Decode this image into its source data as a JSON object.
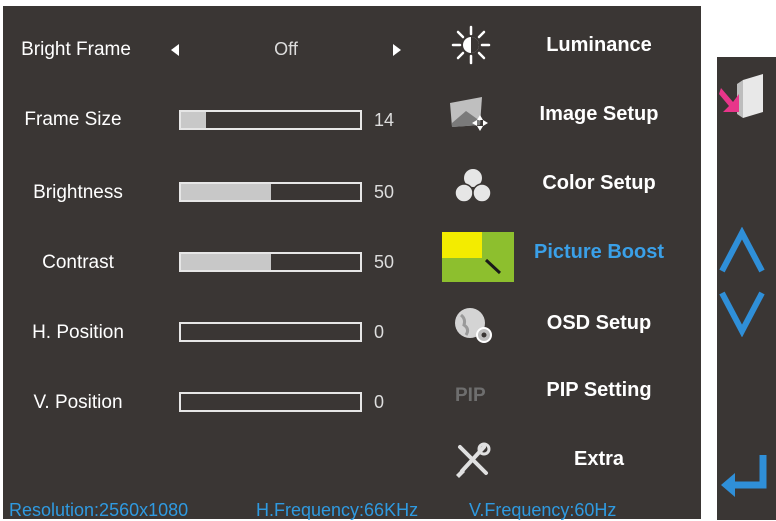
{
  "settings": [
    {
      "label": "Bright Frame",
      "type": "selector",
      "value": "Off"
    },
    {
      "label": "Frame Size",
      "type": "bar",
      "value": "14",
      "level": 0.14
    },
    {
      "label": "Brightness",
      "type": "bar",
      "value": "50",
      "level": 0.5
    },
    {
      "label": "Contrast",
      "type": "bar",
      "value": "50",
      "level": 0.5
    },
    {
      "label": "H. Position",
      "type": "bar",
      "value": "0",
      "level": 0
    },
    {
      "label": "V. Position",
      "type": "bar",
      "value": "0",
      "level": 0
    }
  ],
  "menu": [
    {
      "label": "Luminance",
      "icon": "sun-icon",
      "active": false
    },
    {
      "label": "Image Setup",
      "icon": "image-setup-icon",
      "active": false
    },
    {
      "label": "Color Setup",
      "icon": "color-circles-icon",
      "active": false
    },
    {
      "label": "Picture Boost",
      "icon": "picture-boost-icon",
      "active": true
    },
    {
      "label": "OSD Setup",
      "icon": "osd-gear-icon",
      "active": false
    },
    {
      "label": "PIP Setting",
      "icon": "pip-icon",
      "active": false
    },
    {
      "label": "Extra",
      "icon": "tools-icon",
      "active": false
    }
  ],
  "pip_icon_text": "PIP",
  "status": {
    "resolution": "Resolution:2560x1080",
    "h_frequency": "H.Frequency:66KHz",
    "v_frequency": "V.Frequency:60Hz"
  },
  "colors": {
    "panel_bg": "#3a3634",
    "active_text": "#3aa0e8",
    "status_text": "#2f9ae0",
    "nav_arrow": "#2f8fd8",
    "boost_green": "#8dbf2e",
    "boost_yellow": "#f3ec00"
  }
}
